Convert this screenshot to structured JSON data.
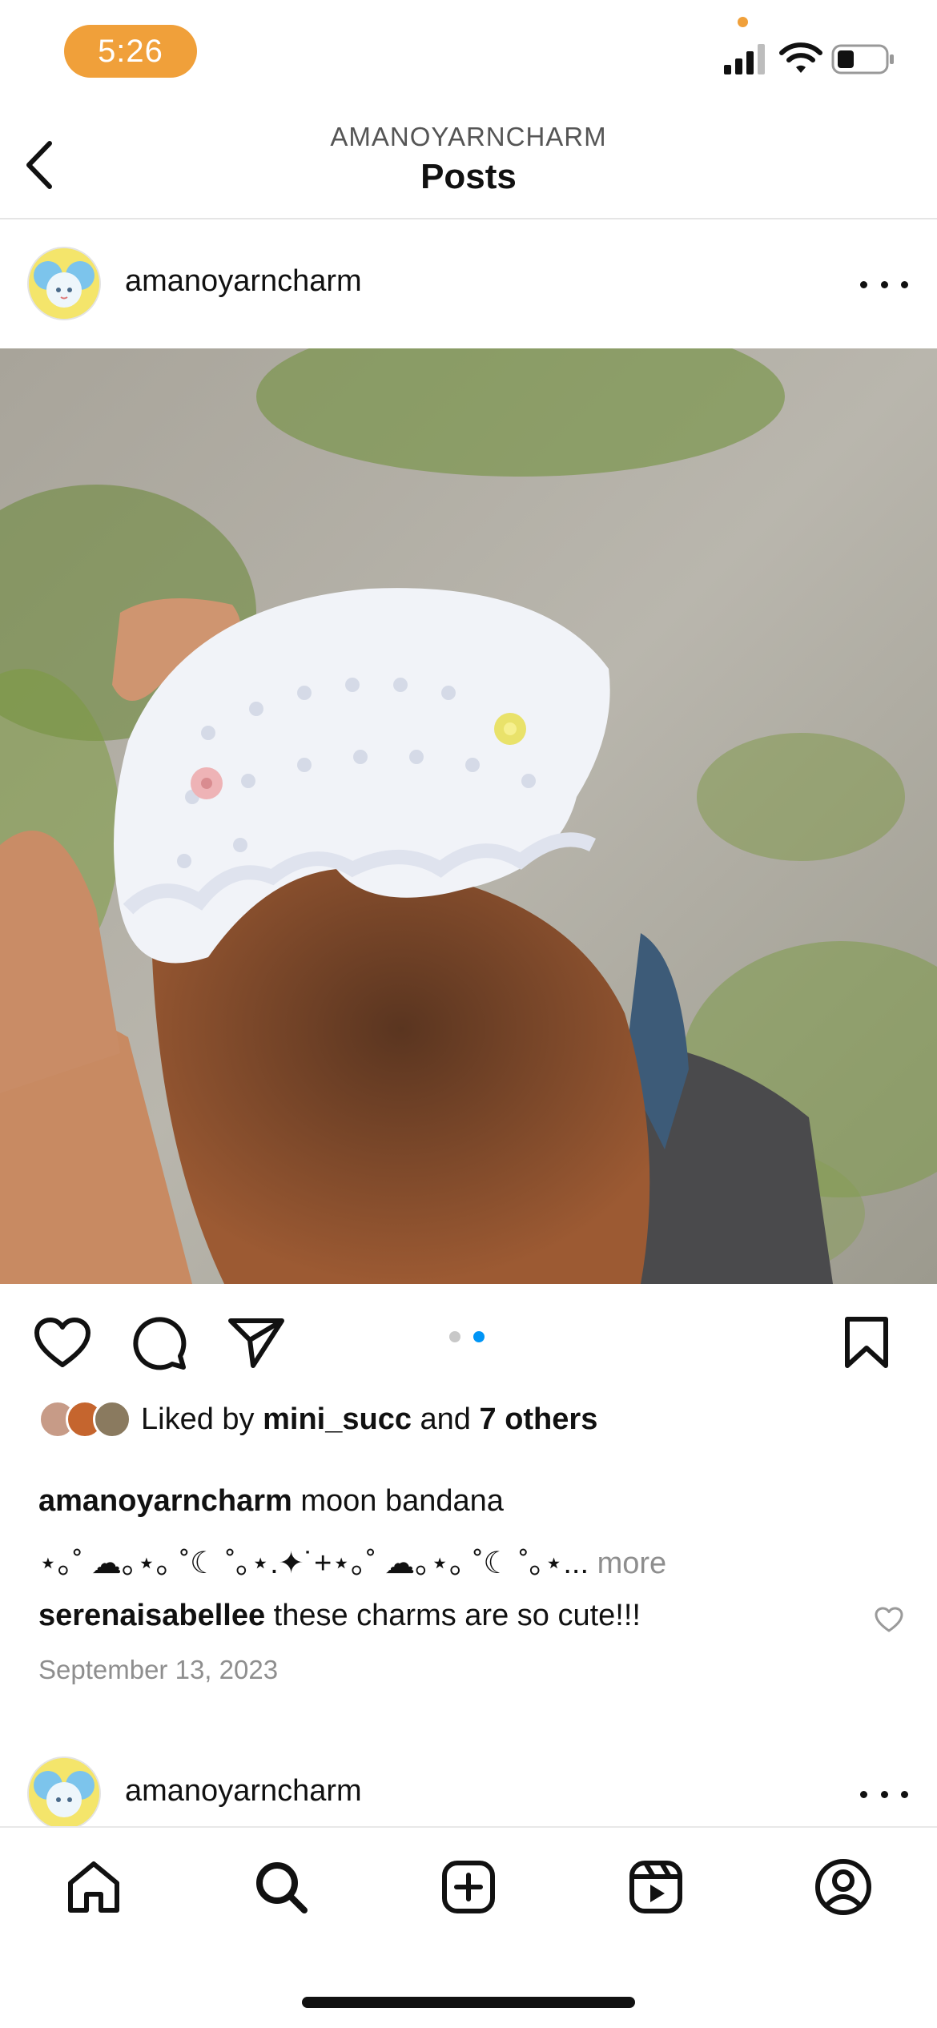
{
  "status_bar": {
    "time": "5:26"
  },
  "header": {
    "subtitle": "AMANOYARNCHARM",
    "title": "Posts"
  },
  "post1": {
    "username": "amanoyarncharm",
    "liked_by_prefix": "Liked by ",
    "liked_by_user": "mini_succ",
    "liked_by_and": " and ",
    "liked_by_others": "7 others",
    "caption_user": "amanoyarncharm",
    "caption_text": " moon bandana",
    "caption_emoji_line": "⋆｡˚ ☁︎｡⋆｡ ˚☾ ˚｡⋆.✦˙+⋆｡˚ ☁︎｡⋆｡ ˚☾ ˚｡⋆...",
    "more_label": " more",
    "comment_user": "serenaisabellee",
    "comment_text": " these charms are so cute!!!",
    "date": "September 13, 2023",
    "carousel": {
      "count": 2,
      "active_index": 1
    }
  },
  "post2": {
    "username": "amanoyarncharm"
  },
  "colors": {
    "accent_blue": "#0095f6",
    "status_orange": "#f0a03a"
  },
  "tab_bar": {
    "items": [
      {
        "name": "home-tab",
        "icon": "home-icon"
      },
      {
        "name": "search-tab",
        "icon": "search-icon"
      },
      {
        "name": "create-tab",
        "icon": "plus-square-icon"
      },
      {
        "name": "reels-tab",
        "icon": "reels-icon"
      },
      {
        "name": "profile-tab",
        "icon": "profile-icon"
      }
    ]
  }
}
